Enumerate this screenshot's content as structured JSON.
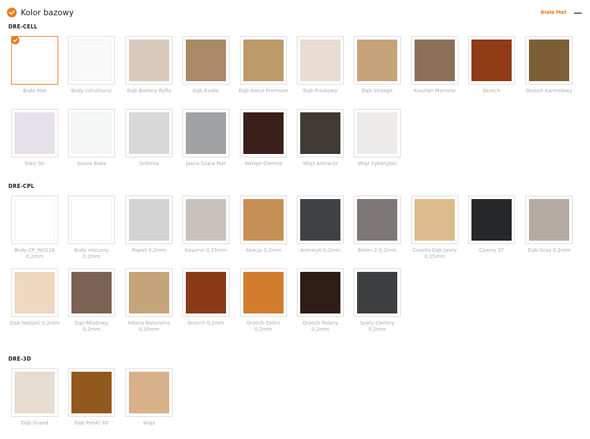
{
  "header": {
    "title": "Kolor bazowy",
    "selected_value": "Biała Mat"
  },
  "sections": [
    {
      "label": "DRE-CELL",
      "swatches": [
        {
          "label": "Biała Mat",
          "color": "#ffffff",
          "selected": true
        },
        {
          "label": "Biały (struktura)",
          "color": "#f9f9f9"
        },
        {
          "label": "Dąb Bielony Ryfla",
          "color": "#d9c9bc"
        },
        {
          "label": "Dąb Evoke",
          "color": "#a98a67"
        },
        {
          "label": "Dąb Natur Premium",
          "color": "#bd9a6a"
        },
        {
          "label": "Dąb Piaskowy",
          "color": "#e8dcd0"
        },
        {
          "label": "Dąb Vintage",
          "color": "#c6a37a"
        },
        {
          "label": "Kasztan Marrone",
          "color": "#8c7057"
        },
        {
          "label": "Orzech",
          "color": "#8f3b16"
        },
        {
          "label": "Orzech Karmelowy",
          "color": "#7d5f35"
        },
        {
          "label": "Siwy Str",
          "color": "#e6e0e8"
        },
        {
          "label": "Sosna Biała",
          "color": "#f5f8f6"
        },
        {
          "label": "Srebrna",
          "color": "#d8d8d8"
        },
        {
          "label": "Jasna Szara Mat",
          "color": "#a0a2a3"
        },
        {
          "label": "Wenge Ciemne",
          "color": "#3a1f1a"
        },
        {
          "label": "Wiąz Antracyt",
          "color": "#3f3a33"
        },
        {
          "label": "Wiąz Syberyjski",
          "color": "#ecebea"
        }
      ]
    },
    {
      "label": "DRE-CPL",
      "swatches": [
        {
          "label": "Biały CP_W0118 0,2mm",
          "color": "#ffffff"
        },
        {
          "label": "Biały mleczny 0,2mm",
          "color": "#ffffff"
        },
        {
          "label": "Popiel 0,2mm",
          "color": "#d2d2d2"
        },
        {
          "label": "Kaszmir 0,15mm",
          "color": "#c9c2bd"
        },
        {
          "label": "Akacja 0,2mm",
          "color": "#c58f55"
        },
        {
          "label": "Antracyt 0,2mm",
          "color": "#3f4245"
        },
        {
          "label": "Beton 2 0,2mm",
          "color": "#7d7775"
        },
        {
          "label": "Casella Dąb Jasny 0,15mm",
          "color": "#dcbb8d"
        },
        {
          "label": "Czarny ST",
          "color": "#252729"
        },
        {
          "label": "Dąb Gray 0,2mm",
          "color": "#b5aba3"
        },
        {
          "label": "Dąb Walijski 0,2mm",
          "color": "#eed7be"
        },
        {
          "label": "Dąb Miodowy 0,2mm",
          "color": "#7a6352"
        },
        {
          "label": "Hikora Naturalna 0,15mm",
          "color": "#c5a47a"
        },
        {
          "label": "Orzech 0,2mm",
          "color": "#8a3a17"
        },
        {
          "label": "Orzech Celtni 0,2mm",
          "color": "#d17d2d"
        },
        {
          "label": "Orzech Polany 0,2mm",
          "color": "#2f1d15"
        },
        {
          "label": "Szary Ciemny 0,2mm",
          "color": "#3d3e40"
        }
      ]
    },
    {
      "label": "DRE-3D",
      "swatches": [
        {
          "label": "Dąb Grand",
          "color": "#e6dccf"
        },
        {
          "label": "Dąb Polski 3D",
          "color": "#92591f"
        },
        {
          "label": "Wiąz",
          "color": "#d8b08a"
        }
      ]
    }
  ]
}
